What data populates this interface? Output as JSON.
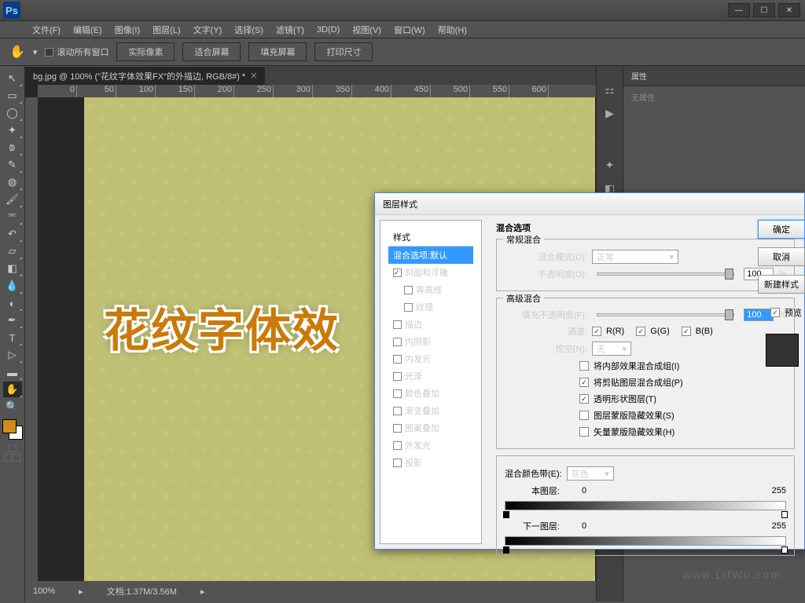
{
  "app": {
    "logo": "Ps"
  },
  "win_btns": {
    "min": "—",
    "max": "☐",
    "close": "✕"
  },
  "menu": [
    "文件(F)",
    "编辑(E)",
    "图像(I)",
    "图层(L)",
    "文字(Y)",
    "选择(S)",
    "滤镜(T)",
    "3D(D)",
    "视图(V)",
    "窗口(W)",
    "帮助(H)"
  ],
  "optbar": {
    "scroll": "滚动所有窗口",
    "b1": "实际像素",
    "b2": "适合屏幕",
    "b3": "填充屏幕",
    "b4": "打印尺寸"
  },
  "tab": {
    "name": "bg.jpg @ 100% (\"花纹字体效果FX\"的外描边, RGB/8#) *"
  },
  "canvas_text": "花纹字体效",
  "panel": {
    "tab": "属性",
    "empty": "无属性"
  },
  "status": {
    "zoom": "100%",
    "doc": "文档:1.37M/3.56M"
  },
  "dialog": {
    "title": "图层样式",
    "styles_hdr": "样式",
    "styles": [
      "混合选项:默认",
      "斜面和浮雕",
      "等高线",
      "纹理",
      "描边",
      "内阴影",
      "内发光",
      "光泽",
      "颜色叠加",
      "渐变叠加",
      "图案叠加",
      "外发光",
      "投影"
    ],
    "blend_title": "混合选项",
    "general": "常规混合",
    "mode_l": "混合模式(D):",
    "mode_v": "正常",
    "opacity_l": "不透明度(O):",
    "opacity_v": "100",
    "pct": "%",
    "adv": "高级混合",
    "fill_l": "填充不透明度(F):",
    "fill_v": "100",
    "chan_l": "通道:",
    "r": "R(R)",
    "g": "G(G)",
    "b": "B(B)",
    "knock_l": "挖空(N):",
    "knock_v": "无",
    "c1": "将内部效果混合成组(I)",
    "c2": "将剪贴图层混合成组(P)",
    "c3": "透明形状图层(T)",
    "c4": "图层蒙版隐藏效果(S)",
    "c5": "矢量蒙版隐藏效果(H)",
    "blendif_l": "混合颜色带(E):",
    "blendif_v": "灰色",
    "this_l": "本图层:",
    "next_l": "下一图层:",
    "v0": "0",
    "v255": "255",
    "ok": "确定",
    "cancel": "取消",
    "new": "新建样式",
    "preview": "预览"
  },
  "watermark": "www.LifWu.com"
}
